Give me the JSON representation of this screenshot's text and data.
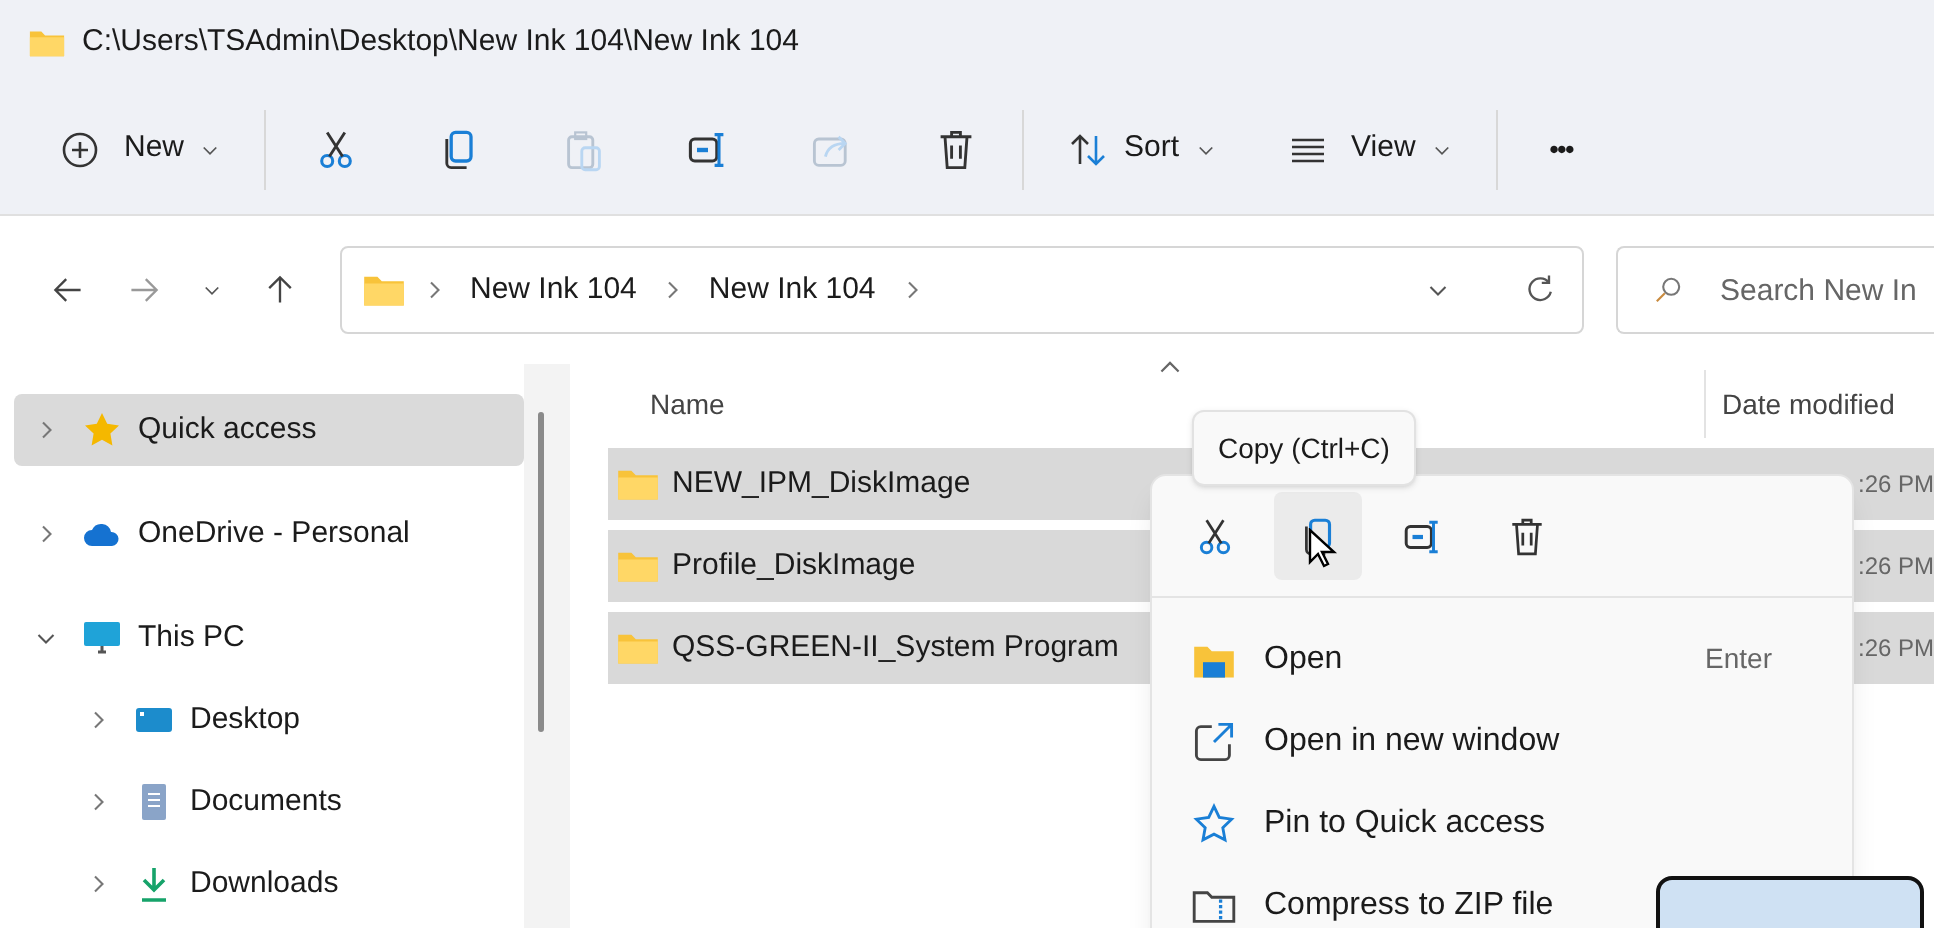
{
  "window": {
    "title": "C:\\Users\\TSAdmin\\Desktop\\New Ink 104\\New Ink 104"
  },
  "toolbar": {
    "new_label": "New",
    "sort_label": "Sort",
    "view_label": "View",
    "more": "•••",
    "actions": [
      {
        "kind": "cut",
        "disabled": false
      },
      {
        "kind": "copy",
        "disabled": false
      },
      {
        "kind": "paste",
        "disabled": true
      },
      {
        "kind": "rename",
        "disabled": false
      },
      {
        "kind": "share",
        "disabled": true
      },
      {
        "kind": "delete",
        "disabled": false
      }
    ]
  },
  "address_bar": {
    "crumbs": [
      "New Ink 104",
      "New Ink 104"
    ]
  },
  "search": {
    "placeholder": "Search New In"
  },
  "sidebar": {
    "items": [
      {
        "label": "Quick access",
        "kind": "star",
        "selected": true,
        "expanded": false
      },
      {
        "label": "OneDrive - Personal",
        "kind": "cloud",
        "selected": false,
        "expanded": false
      },
      {
        "label": "This PC",
        "kind": "monitor",
        "selected": false,
        "expanded": true,
        "children": [
          {
            "label": "Desktop",
            "kind": "desktop",
            "selected": false,
            "expanded": false
          },
          {
            "label": "Documents",
            "kind": "document",
            "selected": false,
            "expanded": false
          },
          {
            "label": "Downloads",
            "kind": "download",
            "selected": false,
            "expanded": false
          }
        ]
      }
    ]
  },
  "table": {
    "columns": [
      "Name",
      "Date modified"
    ],
    "rows": [
      {
        "name": "NEW_IPM_DiskImage",
        "date": ":26 PM",
        "selected": true
      },
      {
        "name": "Profile_DiskImage",
        "date": ":26 PM",
        "selected": true
      },
      {
        "name": "QSS-GREEN-II_System Program",
        "date": ":26 PM",
        "selected": true
      }
    ]
  },
  "tooltip": "Copy (Ctrl+C)",
  "context_menu": {
    "actions": [
      {
        "kind": "cut",
        "selected": false
      },
      {
        "kind": "copy",
        "selected": true
      },
      {
        "kind": "rename",
        "selected": false
      },
      {
        "kind": "delete",
        "selected": false
      }
    ],
    "items": [
      {
        "kind": "open",
        "label": "Open",
        "shortcut": "Enter"
      },
      {
        "kind": "new-window",
        "label": "Open in new window"
      },
      {
        "kind": "pin",
        "label": "Pin to Quick access"
      },
      {
        "kind": "zip",
        "label": "Compress to ZIP file"
      }
    ]
  }
}
